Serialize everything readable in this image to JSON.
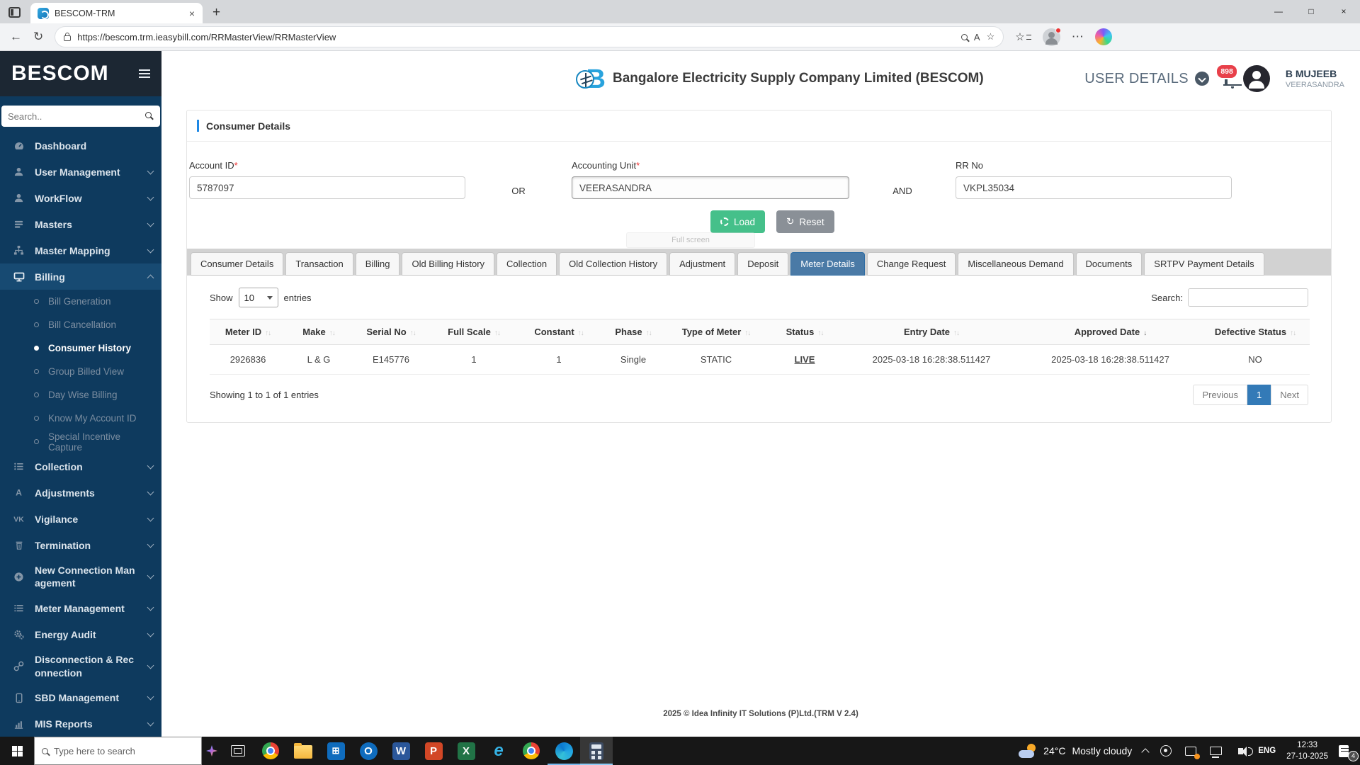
{
  "browser": {
    "tab_title": "BESCOM-TRM",
    "url": "https://bescom.trm.ieasybill.com/RRMasterView/RRMasterView"
  },
  "icons": {
    "minimize": "—",
    "maximize": "□",
    "close": "×",
    "tab_close": "×",
    "new_tab": "+",
    "back": "←",
    "refresh": "↻",
    "read_aloud": "A",
    "favorite_star": "☆",
    "ellipsis": "⋯",
    "sort": "↑↓",
    "sort_down": "↓",
    "reset": "↻"
  },
  "sidebar": {
    "brand": "BESCOM",
    "search_placeholder": "Search..",
    "items": [
      {
        "label": "Dashboard"
      },
      {
        "label": "User Management"
      },
      {
        "label": "WorkFlow"
      },
      {
        "label": "Masters"
      },
      {
        "label": "Master Mapping"
      },
      {
        "label": "Billing"
      },
      {
        "label": "Collection"
      },
      {
        "label": "Adjustments"
      },
      {
        "label": "Vigilance"
      },
      {
        "label": "Termination"
      },
      {
        "label": "New Connection Management"
      },
      {
        "label": "Meter Management"
      },
      {
        "label": "Energy Audit"
      },
      {
        "label": "Disconnection & Reconnection"
      },
      {
        "label": "SBD Management"
      },
      {
        "label": "MIS Reports"
      }
    ],
    "billing_subitems": [
      "Bill Generation",
      "Bill Cancellation",
      "Consumer History",
      "Group Billed View",
      "Day Wise Billing",
      "Know My Account ID",
      "Special Incentive Capture"
    ],
    "active_subitem": "Consumer History"
  },
  "header": {
    "company": "Bangalore Electricity Supply Company Limited (BESCOM)",
    "user_details_label": "USER DETAILS",
    "notification_count": "898",
    "user_name": "B MUJEEB",
    "user_location": "VEERASANDRA"
  },
  "form": {
    "title": "Consumer Details",
    "required_mark": "*",
    "account_id": {
      "label": "Account ID",
      "value": "5787097"
    },
    "or": "OR",
    "accounting_unit": {
      "label": "Accounting Unit",
      "value": "VEERASANDRA"
    },
    "and": "AND",
    "rr_no": {
      "label": "RR No",
      "value": "VKPL35034"
    },
    "load": "Load",
    "reset": "Reset",
    "fullscreen_toast": "Full screen"
  },
  "tabs": {
    "items": [
      "Consumer Details",
      "Transaction",
      "Billing",
      "Old Billing History",
      "Collection",
      "Old Collection History",
      "Adjustment",
      "Deposit",
      "Meter Details",
      "Change Request",
      "Miscellaneous Demand",
      "Documents",
      "SRTPV Payment Details"
    ],
    "active": "Meter Details"
  },
  "table": {
    "show_label": "Show",
    "page_size": "10",
    "entries_label": "entries",
    "search_label": "Search:",
    "columns": [
      "Meter ID",
      "Make",
      "Serial No",
      "Full Scale",
      "Constant",
      "Phase",
      "Type of Meter",
      "Status",
      "Entry Date",
      "Approved Date",
      "Defective Status"
    ],
    "rows": [
      [
        "2926836",
        "L & G",
        "E145776",
        "1",
        "1",
        "Single",
        "STATIC",
        "LIVE",
        "2025-03-18 16:28:38.511427",
        "2025-03-18 16:28:38.511427",
        "NO"
      ]
    ],
    "summary": "Showing 1 to 1 of 1 entries",
    "pagination": {
      "previous": "Previous",
      "page": "1",
      "next": "Next"
    }
  },
  "footer": {
    "text": "2025 © Idea Infinity IT Solutions (P)Ltd.(TRM V 2.4)"
  },
  "taskbar": {
    "search_placeholder": "Type here to search",
    "weather": {
      "temp": "24°C",
      "condition": "Mostly cloudy"
    },
    "language": "ENG",
    "time": "12:33",
    "date": "27-10-2025",
    "notification_badge": "4"
  }
}
